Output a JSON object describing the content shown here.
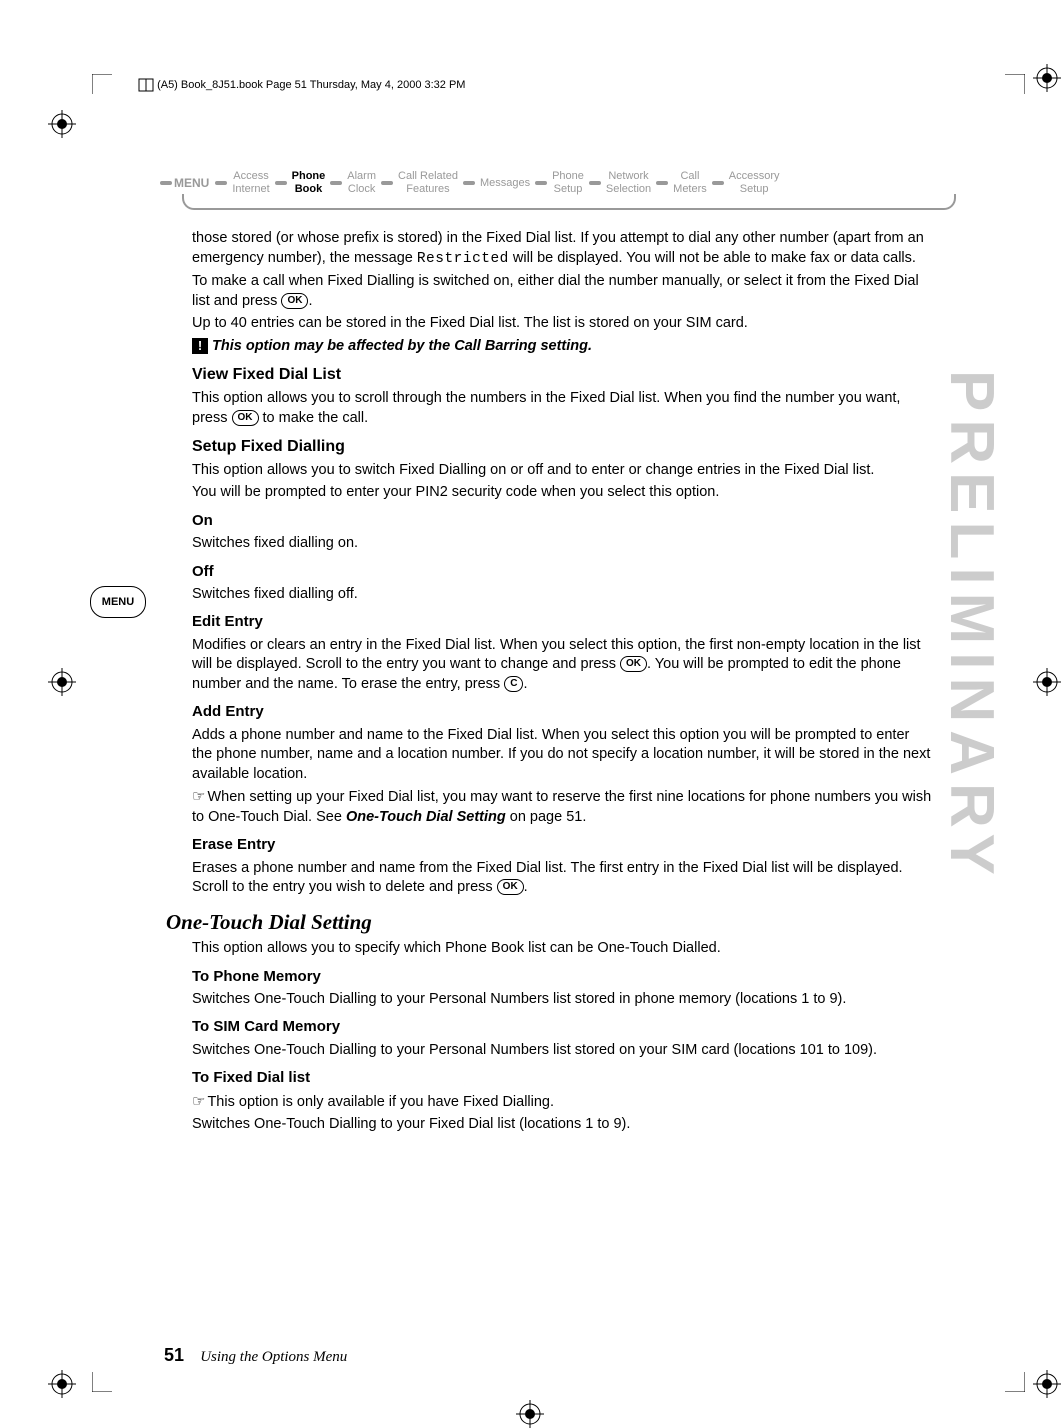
{
  "header": "(A5) Book_8J51.book  Page 51  Thursday, May 4, 2000  3:32 PM",
  "menu": {
    "label": "MENU",
    "items": [
      {
        "top": "Access",
        "bot": "Internet",
        "active": false
      },
      {
        "top": "Phone",
        "bot": "Book",
        "active": true
      },
      {
        "top": "Alarm",
        "bot": "Clock",
        "active": false
      },
      {
        "top": "Call Related",
        "bot": "Features",
        "active": false
      },
      {
        "top": "Messages",
        "bot": "",
        "active": false
      },
      {
        "top": "Phone",
        "bot": "Setup",
        "active": false
      },
      {
        "top": "Network",
        "bot": "Selection",
        "active": false
      },
      {
        "top": "Call",
        "bot": "Meters",
        "active": false
      },
      {
        "top": "Accessory",
        "bot": "Setup",
        "active": false
      }
    ]
  },
  "body": {
    "p1a": "those stored (or whose prefix is stored) in the Fixed Dial list. If you attempt to dial any other number (apart from an emergency number), the message ",
    "p1code": "Restricted",
    "p1b": " will be displayed. You will not be able to make fax or data calls.",
    "p2a": "To make a call when Fixed Dialling is switched on, either dial the number manually, or select it from the Fixed Dial list and press ",
    "p2b": ".",
    "p3": "Up to 40 entries can be stored in the Fixed Dial list. The list is stored on your SIM card.",
    "note1": "This option may be affected by the Call Barring setting.",
    "h_viewfixed": "View Fixed Dial List",
    "p4a": "This option allows you to scroll through the numbers in the Fixed Dial list. When you find the number you want, press ",
    "p4b": " to make the call.",
    "h_setupfixed": "Setup Fixed Dialling",
    "p5": "This option allows you to switch Fixed Dialling on or off and to enter or change entries in the Fixed Dial list.",
    "p6": "You will be prompted to enter your PIN2 security code when you select this option.",
    "h_on": "On",
    "p7": "Switches fixed dialling on.",
    "h_off": "Off",
    "p8": "Switches fixed dialling off.",
    "h_edit": "Edit Entry",
    "p9a": "Modifies or clears an entry in the Fixed Dial list. When you select this option, the first non-empty location in the list will be displayed. Scroll to the entry you want to change and press ",
    "p9b": ". You will be prompted to edit the phone number and the name. To erase the entry, press ",
    "p9c": ".",
    "h_add": "Add Entry",
    "p10": "Adds a phone number and name to the Fixed Dial list. When you select this option you will be prompted to enter the phone number, name and a location number. If you do not specify a location number, it will be stored in the next available location.",
    "p11a": "When setting up your Fixed Dial list, you may want to reserve the first nine locations for phone numbers you wish to One-Touch Dial. See ",
    "p11link": "One-Touch Dial Setting",
    "p11b": " on page 51.",
    "h_erase": "Erase Entry",
    "p12a": "Erases a phone number and name from the Fixed Dial list. The first entry in the Fixed Dial list will be displayed. Scroll to the entry you wish to delete and press ",
    "p12b": ".",
    "h_onetouch": "One-Touch Dial Setting",
    "p13": "This option allows you to specify which Phone Book list can be One-Touch Dialled.",
    "h_tophone": "To Phone Memory",
    "p14": "Switches One-Touch Dialling to your Personal Numbers list stored in phone memory (locations 1 to 9).",
    "h_tosim": "To SIM Card Memory",
    "p15": "Switches One-Touch Dialling to your Personal Numbers list stored on your SIM card (locations 101 to 109).",
    "h_tofixed": "To Fixed Dial list",
    "p16": "This option is only available if you have Fixed Dialling.",
    "p17": "Switches One-Touch Dialling to your Fixed Dial list (locations 1 to 9)."
  },
  "buttons": {
    "ok": "OK",
    "c": "C"
  },
  "sideMenu": "MENU",
  "watermark": "PRELIMINARY",
  "footer": {
    "page": "51",
    "title": "Using the Options Menu"
  }
}
